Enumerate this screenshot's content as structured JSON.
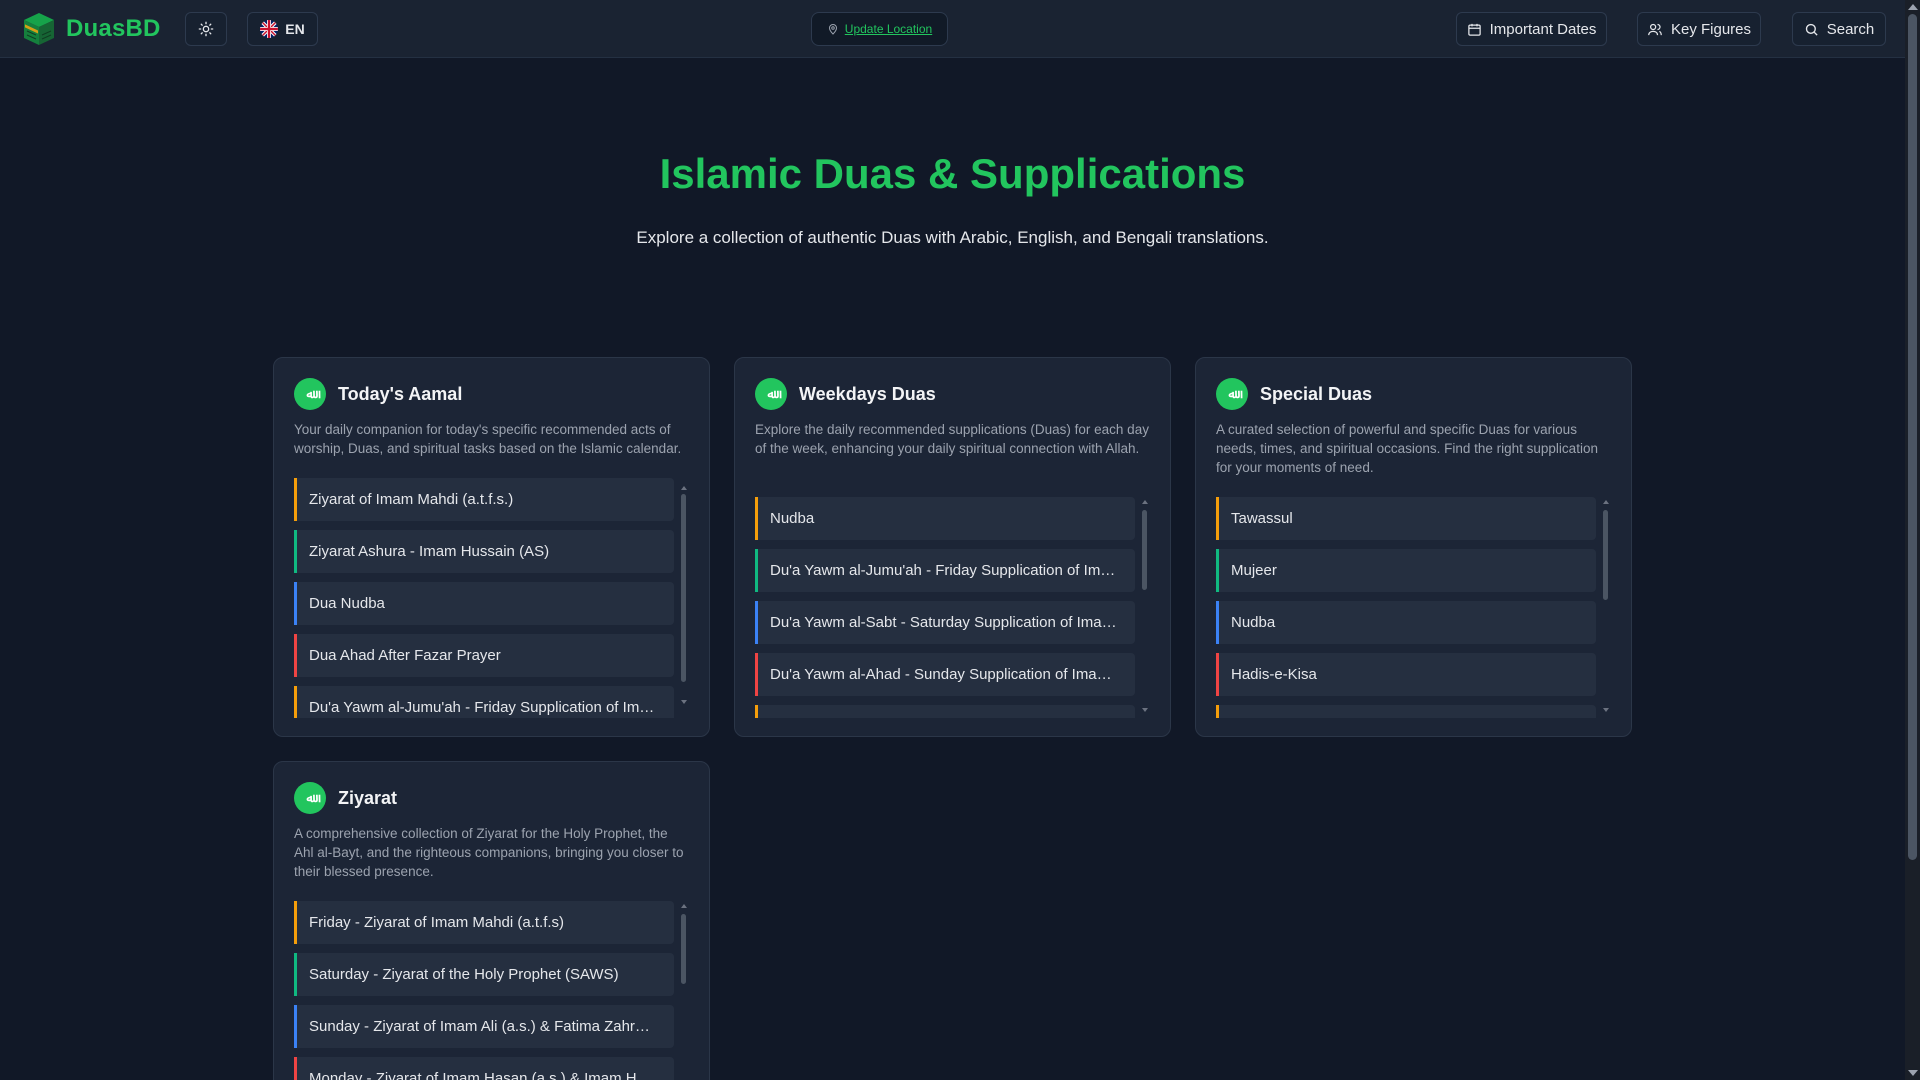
{
  "header": {
    "brand": "DuasBD",
    "lang": "EN",
    "location_label": "Update Location",
    "important_dates": "Important Dates",
    "key_figures": "Key Figures",
    "search": "Search"
  },
  "hero": {
    "title": "Islamic Duas & Supplications",
    "subtitle": "Explore a collection of authentic Duas with Arabic, English, and Bengali translations."
  },
  "cards": [
    {
      "icon_text": "ﷲ",
      "title": "Today's Aamal",
      "description": "Your daily companion for today's specific recommended acts of worship, Duas, and spiritual tasks based on the Islamic calendar.",
      "items": [
        "Ziyarat of Imam Mahdi (a.t.f.s.)",
        "Ziyarat Ashura - Imam Hussain (AS)",
        "Dua Nudba",
        "Dua Ahad After Fazar Prayer",
        "Du'a Yawm al-Jumu'ah - Friday Supplication of Im…"
      ]
    },
    {
      "icon_text": "ﷲ",
      "title": "Weekdays Duas",
      "description": "Explore the daily recommended supplications (Duas) for each day of the week, enhancing your daily spiritual connection with Allah.",
      "items": [
        "Nudba",
        "Du'a Yawm al-Jumu'ah - Friday Supplication of Im…",
        "Du'a Yawm al-Sabt - Saturday Supplication of Ima…",
        "Du'a Yawm al-Ahad - Sunday Supplication of Ima…",
        ""
      ]
    },
    {
      "icon_text": "ﷲ",
      "title": "Special Duas",
      "description": "A curated selection of powerful and specific Duas for various needs, times, and spiritual occasions. Find the right supplication for your moments of need.",
      "items": [
        "Tawassul",
        "Mujeer",
        "Nudba",
        "Hadis-e-Kisa",
        ""
      ]
    },
    {
      "icon_text": "ﷲ",
      "title": "Ziyarat",
      "description": "A comprehensive collection of Ziyarat for the Holy Prophet, the Ahl al-Bayt, and the righteous companions, bringing you closer to their blessed presence.",
      "items": [
        "Friday - Ziyarat of Imam Mahdi (a.t.f.s)",
        "Saturday - Ziyarat of the Holy Prophet (SAWS)",
        "Sunday - Ziyarat of Imam Ali (a.s.) & Fatima Zahr…",
        "Monday - Ziyarat of Imam Hasan (a.s.) & Imam H…"
      ]
    }
  ],
  "colors": {
    "accent": "#22c55e",
    "background": "#111827",
    "card": "#1c2536",
    "item_borders": [
      "#f59e0b",
      "#10b981",
      "#3b82f6",
      "#ef4444",
      "#f59e0b"
    ]
  }
}
